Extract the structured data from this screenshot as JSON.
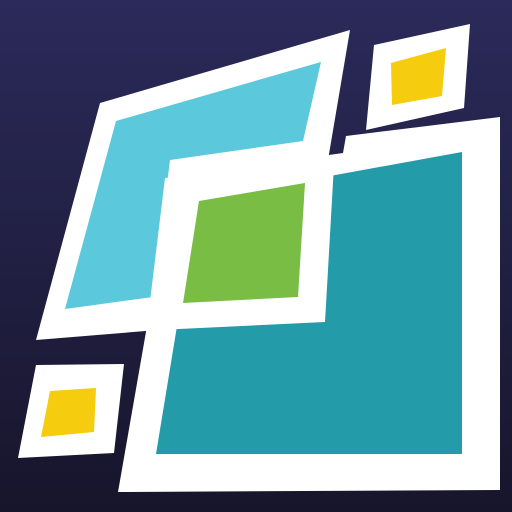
{
  "app_icon": {
    "icon": "overlapping-tilted-squares-logo-icon",
    "colors": {
      "background_top": "#2b2a5a",
      "background_bottom": "#17152b",
      "outline": "#ffffff",
      "light_blue": "#5bc8dc",
      "teal": "#239ba8",
      "green": "#79bd45",
      "yellow": "#f5cc0e"
    }
  }
}
